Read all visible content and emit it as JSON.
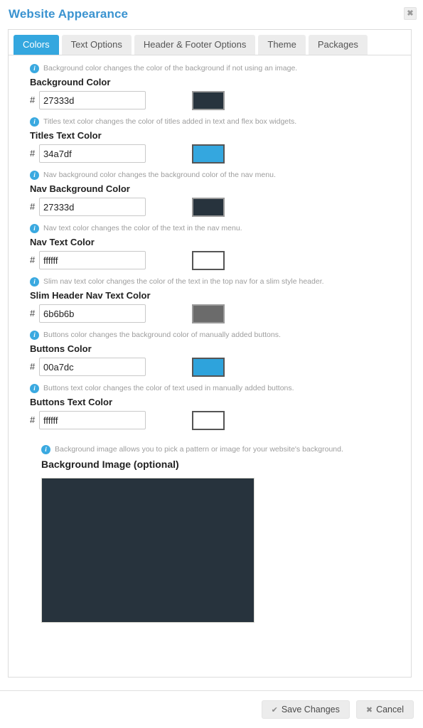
{
  "header": {
    "title": "Website Appearance",
    "close_label": "✖",
    "close_icon": "close-icon"
  },
  "tabs": [
    {
      "label": "Colors",
      "active": true
    },
    {
      "label": "Text Options",
      "active": false
    },
    {
      "label": "Header & Footer Options",
      "active": false
    },
    {
      "label": "Theme",
      "active": false
    },
    {
      "label": "Packages",
      "active": false
    }
  ],
  "fields": [
    {
      "hint": "Background color changes the color of the background if not using an image.",
      "label": "Background Color",
      "prefix": "#",
      "value": "27333d",
      "swatch_color": "#27333d",
      "swatch_border": "light"
    },
    {
      "hint": "Titles text color changes the color of titles added in text and flex box widgets.",
      "label": "Titles Text Color",
      "prefix": "#",
      "value": "34a7df",
      "swatch_color": "#34a7df",
      "swatch_border": "dark"
    },
    {
      "hint": "Nav background color changes the background color of the nav menu.",
      "label": "Nav Background Color",
      "prefix": "#",
      "value": "27333d",
      "swatch_color": "#27333d",
      "swatch_border": "light"
    },
    {
      "hint": "Nav text color changes the color of the text in the nav menu.",
      "label": "Nav Text Color",
      "prefix": "#",
      "value": "ffffff",
      "swatch_color": "#ffffff",
      "swatch_border": "dark"
    },
    {
      "hint": "Slim nav text color changes the color of the text in the top nav for a slim style header.",
      "label": "Slim Header Nav Text Color",
      "prefix": "#",
      "value": "6b6b6b",
      "swatch_color": "#6b6b6b",
      "swatch_border": "light"
    },
    {
      "hint": "Buttons color changes the background color of manually added buttons.",
      "label": "Buttons Color",
      "prefix": "#",
      "value": "00a7dc",
      "swatch_color": "#2ea3dc",
      "swatch_border": "dark"
    },
    {
      "hint": "Buttons text color changes the color of text used in manually added buttons.",
      "label": "Buttons Text Color",
      "prefix": "#",
      "value": "ffffff",
      "swatch_color": "#ffffff",
      "swatch_border": "dark"
    }
  ],
  "background_image": {
    "hint": "Background image allows you to pick a pattern or image for your website's background.",
    "label": "Background Image (optional)",
    "preview_color": "#27333d"
  },
  "footer": {
    "save_glyph": "✔",
    "save_label": "Save Changes",
    "cancel_glyph": "✖",
    "cancel_label": "Cancel"
  }
}
